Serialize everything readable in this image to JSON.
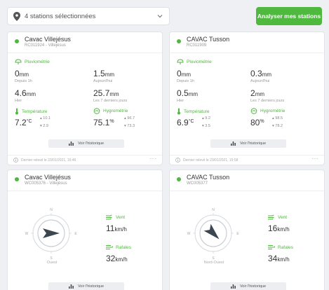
{
  "selector": {
    "label": "4 stations sélectionnées"
  },
  "analyse_button": "Analyser mes stations",
  "history_label": "Voir l'historique",
  "colors": {
    "accent": "#4fb83e",
    "button": "#4fb83e"
  },
  "labels": {
    "pluvio": "Pluviométrie",
    "since1h": "Depuis 1h",
    "today": "Aujourd'hui",
    "yesterday": "Hier",
    "last7": "Les 7 derniers jours",
    "temperature": "Température",
    "hygro": "Hygrométrie",
    "vent": "Vent",
    "rafales": "Rafales"
  },
  "cards": [
    {
      "name": "Cavac Villejésus",
      "code": "RC011924 - Villejésus",
      "rain": {
        "h1": "0",
        "today": "1.5",
        "yesterday": "4.6",
        "week": "25.7",
        "unit": "mm"
      },
      "temp": {
        "value": "7.2",
        "unit": "°C",
        "max": "10.1",
        "min": "2.9"
      },
      "hygro": {
        "value": "75.1",
        "unit": "%",
        "max": "96.7",
        "min": "73.3"
      },
      "footer": "Dernier relevé le 23/01/2021, 15:46",
      "more": "···"
    },
    {
      "name": "CAVAC Tusson",
      "code": "RC011909",
      "rain": {
        "h1": "0",
        "today": "0.3",
        "yesterday": "0.5",
        "week": "2",
        "unit": "mm"
      },
      "temp": {
        "value": "6.9",
        "unit": "°C",
        "max": "9.2",
        "min": "3.5"
      },
      "hygro": {
        "value": "80",
        "unit": "%",
        "max": "98.5",
        "min": "78.2"
      },
      "footer": "Dernier relevé le 23/01/2021, 15:58",
      "more": "···"
    },
    {
      "name": "Cavac Villejésus",
      "code": "WC005376 - Villejésus",
      "compass": {
        "n": "N",
        "s": "S",
        "e": "E",
        "w": "W",
        "direction": "Ouest",
        "arrow_rotation_deg": 0
      },
      "wind": {
        "value": "11",
        "unit": "km/h"
      },
      "gusts": {
        "value": "32",
        "unit": "km/h"
      }
    },
    {
      "name": "CAVAC Tusson",
      "code": "WC005377",
      "compass": {
        "n": "N",
        "s": "S",
        "e": "E",
        "w": "W",
        "direction": "Nord-Ouest",
        "arrow_rotation_deg": 45
      },
      "wind": {
        "value": "16",
        "unit": "km/h"
      },
      "gusts": {
        "value": "34",
        "unit": "km/h"
      }
    }
  ]
}
